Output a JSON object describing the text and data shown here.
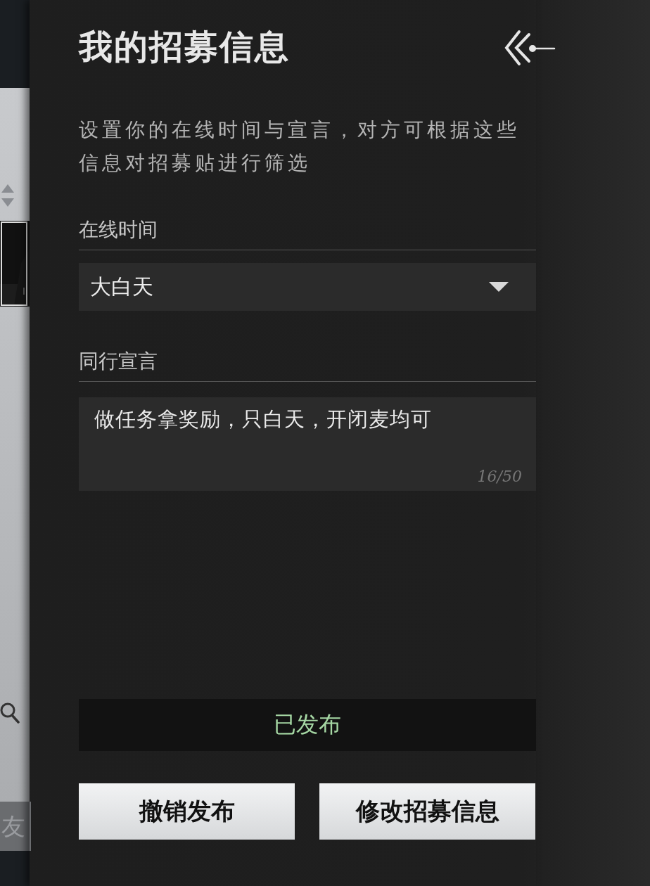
{
  "side_panel": {
    "partial_label": "友"
  },
  "title": "我的招募信息",
  "description": "设置你的在线时间与宣言，对方可根据这些信息对招募贴进行筛选",
  "online_time": {
    "label": "在线时间",
    "value": "大白天"
  },
  "declaration": {
    "label": "同行宣言",
    "value": "做任务拿奖励，只白天，开闭麦均可",
    "count": "16/50"
  },
  "status": "已发布",
  "buttons": [
    {
      "label": "撤销发布"
    },
    {
      "label": "修改招募信息"
    }
  ]
}
